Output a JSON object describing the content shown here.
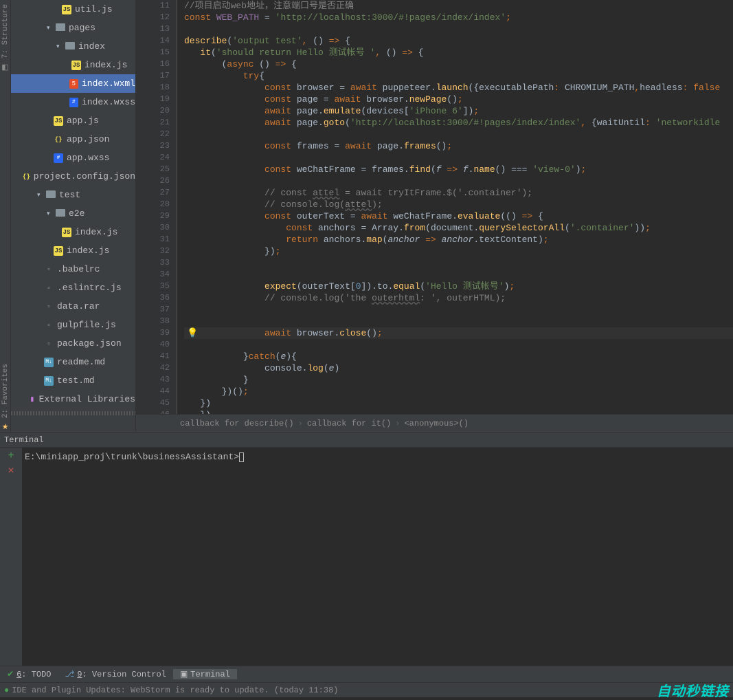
{
  "leftRail": {
    "structure": "7: Structure",
    "favorites": "2: Favorites"
  },
  "fileTree": [
    {
      "indent": 68,
      "icon": "js",
      "label": "util.js",
      "type": "file"
    },
    {
      "indent": 46,
      "icon": "folder",
      "label": "pages",
      "type": "folder",
      "open": true
    },
    {
      "indent": 60,
      "icon": "folder",
      "label": "index",
      "type": "folder",
      "open": true
    },
    {
      "indent": 82,
      "icon": "js",
      "label": "index.js",
      "type": "file"
    },
    {
      "indent": 82,
      "icon": "html",
      "label": "index.wxml",
      "type": "file",
      "selected": true
    },
    {
      "indent": 82,
      "icon": "css",
      "label": "index.wxss",
      "type": "file"
    },
    {
      "indent": 56,
      "icon": "js",
      "label": "app.js",
      "type": "file"
    },
    {
      "indent": 56,
      "icon": "json",
      "label": "app.json",
      "type": "file"
    },
    {
      "indent": 56,
      "icon": "css",
      "label": "app.wxss",
      "type": "file"
    },
    {
      "indent": 56,
      "icon": "json",
      "label": "project.config.json",
      "type": "file"
    },
    {
      "indent": 32,
      "icon": "folder",
      "label": "test",
      "type": "folder",
      "open": true
    },
    {
      "indent": 46,
      "icon": "folder",
      "label": "e2e",
      "type": "folder",
      "open": true
    },
    {
      "indent": 68,
      "icon": "js",
      "label": "index.js",
      "type": "file"
    },
    {
      "indent": 56,
      "icon": "js",
      "label": "index.js",
      "type": "file"
    },
    {
      "indent": 42,
      "icon": "misc",
      "label": ".babelrc",
      "type": "file"
    },
    {
      "indent": 42,
      "icon": "misc",
      "label": ".eslintrc.js",
      "type": "file"
    },
    {
      "indent": 42,
      "icon": "misc",
      "label": "data.rar",
      "type": "file"
    },
    {
      "indent": 42,
      "icon": "misc",
      "label": "gulpfile.js",
      "type": "file"
    },
    {
      "indent": 42,
      "icon": "misc",
      "label": "package.json",
      "type": "file"
    },
    {
      "indent": 42,
      "icon": "md",
      "label": "readme.md",
      "type": "file"
    },
    {
      "indent": 42,
      "icon": "md",
      "label": "test.md",
      "type": "file"
    },
    {
      "indent": 30,
      "icon": "lib",
      "label": "External Libraries",
      "type": "lib"
    }
  ],
  "code": {
    "startLine": 11,
    "lines": [
      "<span class='cmt'>//项目启动web地址，注意端口号是否正确</span>",
      "<span class='kw'>const </span><span class='glob'>WEB_PATH</span> <span class='id'>=</span> <span class='str'>'http://localhost:3000/#!pages/index/index'</span><span class='kw'>;</span>",
      "",
      "<span class='fn'>describe</span>(<span class='str'>'output test'</span><span class='kw'>,</span> () <span class='kw'>=&gt;</span> {",
      "   <span class='fn'>it</span>(<span class='str'>'should return Hello 测试帐号 '</span><span class='kw'>,</span> () <span class='kw'>=&gt;</span> {",
      "       (<span class='kw'>async</span> () <span class='kw'>=&gt;</span> {",
      "           <span class='kw'>try</span>{",
      "               <span class='kw'>const </span><span class='id'>browser</span> = <span class='kw'>await </span><span class='id'>puppeteer</span>.<span class='fn'>launch</span>({<span class='id'>executablePath</span><span class='kw'>:</span> <span class='id'>CHROMIUM_PATH</span><span class='kw'>,</span><span class='id'>headless</span><span class='kw'>:</span> <span class='kw'>false</span>",
      "               <span class='kw'>const </span><span class='id'>page</span> = <span class='kw'>await </span><span class='id'>browser</span>.<span class='fn'>newPage</span>()<span class='kw'>;</span>",
      "               <span class='kw'>await </span><span class='id'>page</span>.<span class='fn'>emulate</span>(<span class='id'>devices</span>[<span class='str'>'iPhone 6'</span>])<span class='kw'>;</span>",
      "               <span class='kw'>await </span><span class='id'>page</span>.<span class='fn'>goto</span>(<span class='str'>'http://localhost:3000/#!pages/index/index'</span><span class='kw'>,</span> {<span class='id'>waitUntil</span><span class='kw'>:</span> <span class='str'>'networkidle</span>",
      "",
      "               <span class='kw'>const </span><span class='id'>frames</span> <span class='id'>=</span> <span class='kw'>await </span><span class='id'>page</span>.<span class='fn'>frames</span>()<span class='kw'>;</span>",
      "",
      "               <span class='kw'>const </span><span class='id'>weChatFrame</span> <span class='id'>=</span> <span class='id'>frames</span>.<span class='fn'>find</span>(<span class='param'>f</span> <span class='kw'>=&gt;</span> <span class='param'>f</span>.<span class='fn'>name</span>() <span class='id'>===</span> <span class='str'>'view-0'</span>)<span class='kw'>;</span>",
      "",
      "               <span class='cmt'>// const </span><span class='cmt-u'>attel</span><span class='cmt'> = await tryItFrame.$('.container');</span>",
      "               <span class='cmt'>// console.log(</span><span class='cmt-u'>attel</span><span class='cmt'>);</span>",
      "               <span class='kw'>const </span><span class='id'>outerText</span> <span class='id'>=</span> <span class='kw'>await </span><span class='id'>weChatFrame</span>.<span class='fn'>evaluate</span>(() <span class='kw'>=&gt;</span> {",
      "                   <span class='kw'>const </span><span class='id'>anchors</span> <span class='id'>=</span> <span class='id'>Array</span>.<span class='fn'>from</span>(<span class='id'>document</span>.<span class='fn'>querySelectorAll</span>(<span class='str'>'.container'</span>))<span class='kw'>;</span>",
      "                   <span class='kw'>return </span><span class='id'>anchors</span>.<span class='fn'>map</span>(<span class='param'>anchor</span> <span class='kw'>=&gt;</span> <span class='param'>anchor</span>.<span class='id'>textContent</span>)<span class='kw'>;</span>",
      "               })<span class='kw'>;</span>",
      "",
      "",
      "               <span class='fn'>expect</span>(<span class='id'>outerText</span>[<span class='num'>0</span>]).<span class='id'>to</span>.<span class='fn'>equal</span>(<span class='str'>'Hello 测试帐号'</span>)<span class='kw'>;</span>",
      "               <span class='cmt'>// console.log('the </span><span class='cmt-u'>outerhtml</span><span class='cmt'>: ', outerHTML);</span>",
      "",
      "",
      "               <span class='kw'>await </span><span class='id'>browser</span>.<span class='fn'>close</span>()<span class='kw'>;</span>",
      "",
      "           }<span class='kw'>catch</span>(<span class='param'>e</span>){",
      "               <span class='id'>console</span>.<span class='fn'>log</span>(<span class='param'>e</span>)",
      "           }",
      "       })()<span class='kw'>;</span>",
      "   })",
      "   })"
    ],
    "hlLine": 39
  },
  "breadcrumbs": [
    "callback for describe()",
    "callback for it()",
    "<anonymous>()"
  ],
  "terminal": {
    "title": "Terminal",
    "prompt": "E:\\miniapp_proj\\trunk\\businessAssistant>"
  },
  "statusbar": {
    "todo": "6: TODO",
    "vcs": "9: Version Control",
    "terminal": "Terminal"
  },
  "footer": {
    "message": "IDE and Plugin Updates: WebStorm is ready to update. (today 11:38)",
    "brand": "自动秒链接"
  }
}
